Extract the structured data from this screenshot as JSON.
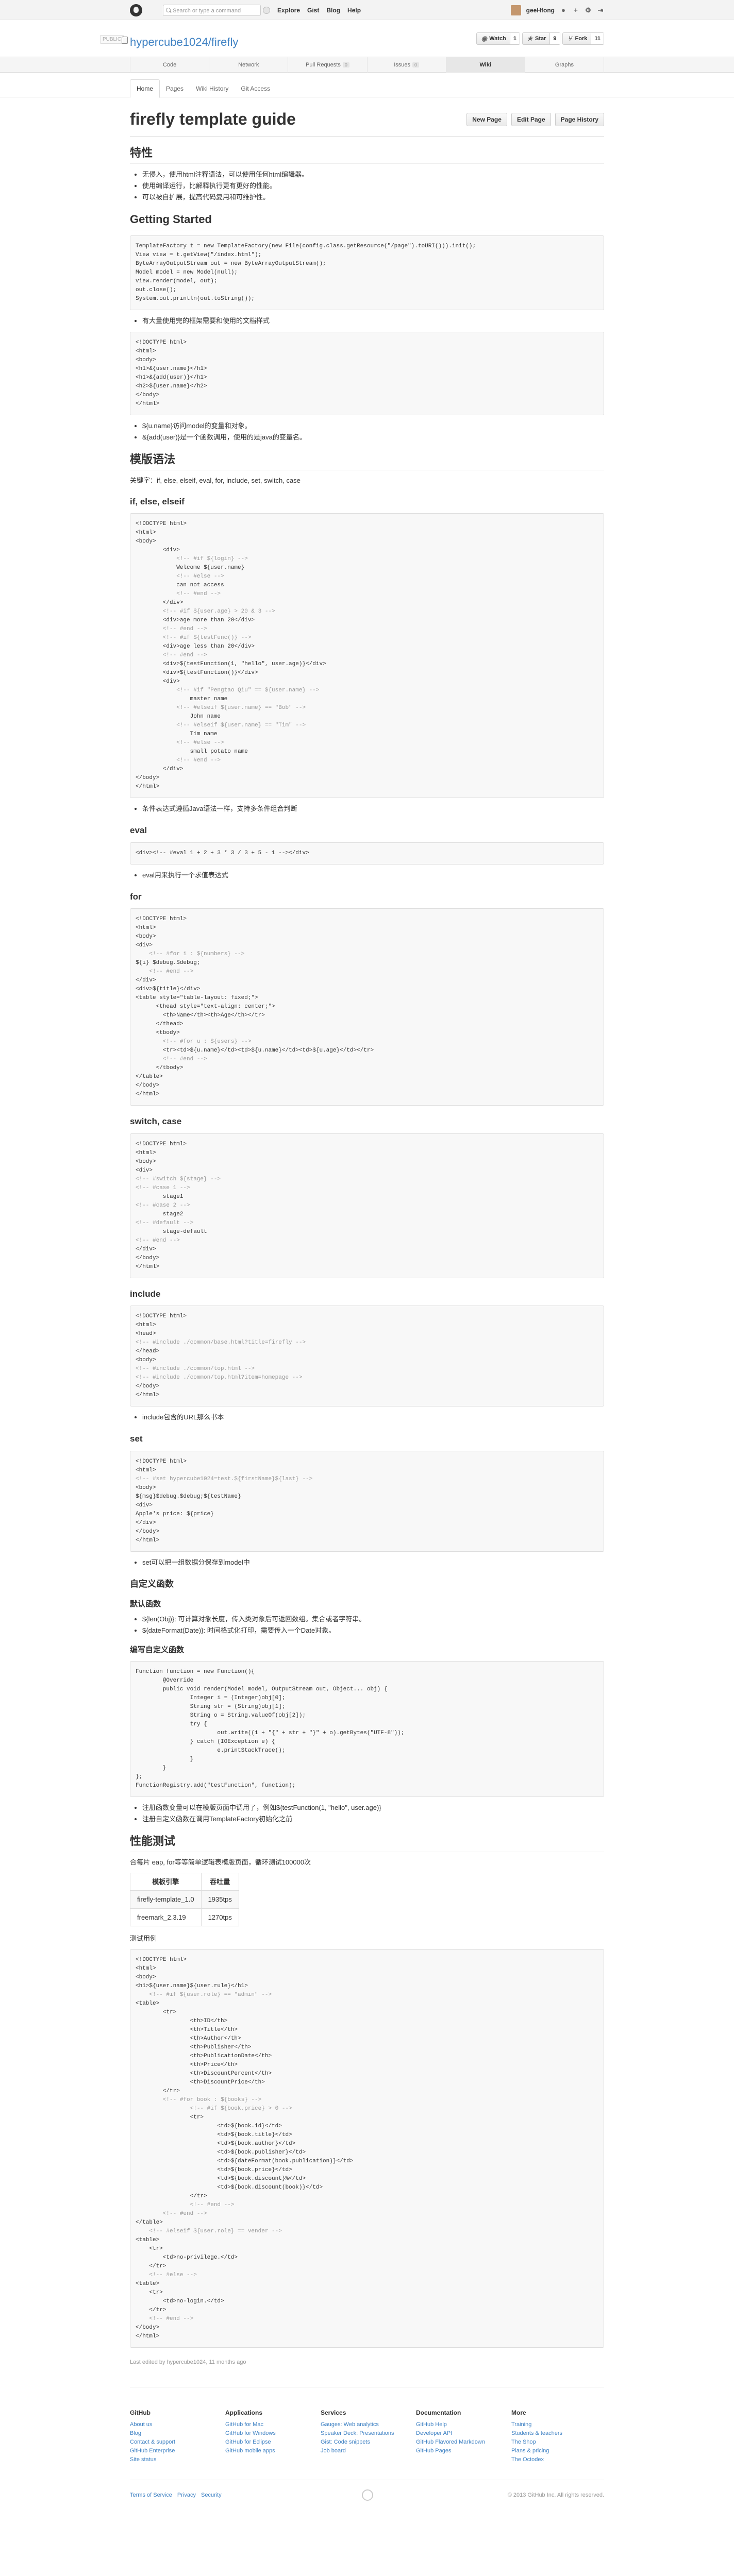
{
  "header": {
    "search_placeholder": "Search or type a command",
    "nav": [
      "Explore",
      "Gist",
      "Blog",
      "Help"
    ],
    "username": "geeHfong"
  },
  "repo": {
    "public_label": "PUBLIC",
    "owner": "hypercube1024",
    "separator": " / ",
    "name": "firefly",
    "watch": "Watch",
    "watch_count": "1",
    "star": "Star",
    "star_count": "9",
    "fork": "Fork",
    "fork_count": "11"
  },
  "tabs": [
    {
      "label": "Code",
      "count": ""
    },
    {
      "label": "Network",
      "count": ""
    },
    {
      "label": "Pull Requests",
      "count": "0"
    },
    {
      "label": "Issues",
      "count": "0"
    },
    {
      "label": "Wiki",
      "count": ""
    },
    {
      "label": "Graphs",
      "count": ""
    }
  ],
  "wiki_nav": [
    "Home",
    "Pages",
    "Wiki History",
    "Git Access"
  ],
  "page": {
    "title": "firefly template guide",
    "buttons": [
      "New Page",
      "Edit Page",
      "Page History"
    ]
  },
  "content": {
    "h_features": "特性",
    "features": [
      "无侵入，使用html注释语法，可以使用任何html编辑器。",
      "使用编译运行，比解释执行更有更好的性能。",
      "可以被自扩展，提高代码复用和可维护性。"
    ],
    "h_started": "Getting Started",
    "started_note": "有大量使用完的框架需要和使用的文档样式",
    "code_started": [
      "TemplateFactory t = new TemplateFactory(new File(config.class.getResource(\"/page\").toURI())).init();",
      "",
      "View view = t.getView(\"/index.html\");",
      "ByteArrayOutputStream out = new ByteArrayOutputStream();",
      "Model model = new Model(null);",
      "view.render(model, out);",
      "out.close();",
      "System.out.println(out.toString());"
    ],
    "started_note2": "有大量使用完的框架需要和使用的文档样式",
    "code_hello": [
      "<!DOCTYPE html>",
      "<html>",
      "<body>",
      "<h1>&{user.name}</h1>",
      "<h1>&{add(user)}</h1>",
      "<h2>${user.name}</h2>",
      "</body>",
      "</html>"
    ],
    "hello_notes": [
      "${u.name}访问model的变量和对象。",
      "&{add(user)}是一个函数调用，使用的是java的变量名。"
    ],
    "h_syntax": "模版语法",
    "syntax_intro": "关键字：if, else, elseif, eval, for, include, set, switch, case",
    "h_if": "if, else, elseif",
    "code_if": [
      "<!DOCTYPE html>",
      "<html>",
      "<body>",
      "",
      "        <div>",
      "            <!-- #if ${login} -->",
      "            Welcome ${user.name}",
      "            <!-- #else -->",
      "            can not access",
      "            <!-- #end -->",
      "        </div>",
      "",
      "        <!-- #if ${user.age} > 20 & 3 -->",
      "        <div>age more than 20</div>",
      "        <!-- #end -->",
      "",
      "        <!-- #if ${testFunc()} -->",
      "        <div>age less than 20</div>",
      "        <!-- #end -->",
      "",
      "        <div>${testFunction(1, \"hello\", user.age)}</div>",
      "        <div>${testFunction()}</div>",
      "",
      "        <div>",
      "            <!-- #if \"Pengtao Qiu\" == ${user.name} -->",
      "                master name",
      "            <!-- #elseif ${user.name} == \"Bob\" -->",
      "                John name",
      "            <!-- #elseif ${user.name} == \"Tim\" -->",
      "                Tim name",
      "            <!-- #else -->",
      "                small potato name",
      "            <!-- #end -->",
      "        </div>",
      "</body>",
      "</html>"
    ],
    "if_note": "条件表达式遵循Java语法一样，支持多条件组合判断",
    "h_eval": "eval",
    "code_eval": [
      "<div><!-- #eval 1 + 2 + 3 * 3 / 3 + 5 - 1 --></div>"
    ],
    "eval_note": "eval用来执行一个求值表达式",
    "h_for": "for",
    "code_for": [
      "<!DOCTYPE html>",
      "<html>",
      "<body>",
      "<div>",
      "    <!-- #for i : ${numbers} -->",
      "${i} $debug.$debug;",
      "    <!-- #end -->",
      "</div>",
      "",
      "<div>${title}</div>",
      "<table style=\"table-layout: fixed;\">",
      "      <thead style=\"text-align: center;\">",
      "        <th>Name</th><th>Age</th></tr>",
      "      </thead>",
      "      <tbody>",
      "        <!-- #for u : ${users} -->",
      "        <tr><td>${u.name}</td><td>${u.name}</td><td>${u.age}</td></tr>",
      "        <!-- #end -->",
      "      </tbody>",
      "</table>",
      "</body>",
      "</html>"
    ],
    "h_switch": "switch, case",
    "code_switch": [
      "<!DOCTYPE html>",
      "<html>",
      "<body>",
      "<div>",
      "<!-- #switch ${stage} -->",
      "<!-- #case 1 -->",
      "        stage1",
      "<!-- #case 2 -->",
      "        stage2",
      "<!-- #default -->",
      "        stage-default",
      "<!-- #end -->",
      "</div>",
      "</body>",
      "</html>"
    ],
    "h_include": "include",
    "code_include": [
      "<!DOCTYPE html>",
      "<html>",
      "<head>",
      "<!-- #include ./common/base.html?title=firefly -->",
      "</head>",
      "<body>",
      "<!-- #include ./common/top.html -->",
      "<!-- #include ./common/top.html?item=homepage -->",
      "</body>",
      "</html>"
    ],
    "include_note": "include包含的URL那么书本",
    "h_set": "set",
    "code_set": [
      "<!DOCTYPE html>",
      "<html>",
      "<!-- #set hypercube1024=test.${firstName}${last} -->",
      "<body>",
      "${msg}$debug.$debug;${testName}",
      "<div>",
      "Apple's price: ${price}",
      "</div>",
      "</body>",
      "</html>"
    ],
    "set_note": "set可以把一组数据分保存到model中",
    "h_funcs": "自定义函数",
    "h_builtin": "默认函数",
    "builtin_notes": [
      "${len(Obj)}: 可计算对象长度，传入类对象后可返回数组。集合或者字符串。",
      "${dateFormat(Date)}: 时间格式化打印，需要传入一个Date对象。"
    ],
    "h_custom": "编写自定义函数",
    "code_func": [
      "Function function = new Function(){",
      "        @Override",
      "        public void render(Model model, OutputStream out, Object... obj) {",
      "                Integer i = (Integer)obj[0];",
      "                String str = (String)obj[1];",
      "                String o = String.valueOf(obj[2]);",
      "",
      "                try {",
      "                        out.write((i + \"{\" + str + \"}\" + o).getBytes(\"UTF-8\"));",
      "                } catch (IOException e) {",
      "                        e.printStackTrace();",
      "                }",
      "        }",
      "};",
      "",
      "FunctionRegistry.add(\"testFunction\", function);"
    ],
    "func_notes": [
      "注册函数变量可以在模版页面中调用了，例如${testFunction(1, \"hello\", user.age)}",
      "注册自定义函数在调用TemplateFactory初始化之前"
    ],
    "h_perf": "性能测试",
    "perf_intro": "合每片 eap, for等等简单逻辑表模版页面，循环测试100000次",
    "perf_headers": [
      "模板引擎",
      "吞吐量"
    ],
    "perf_rows": [
      [
        "firefly-template_1.0",
        "1935tps"
      ],
      [
        "freemark_2.3.19",
        "1270tps"
      ]
    ],
    "perf_code_label": "测试用例",
    "code_perf": [
      "<!DOCTYPE html>",
      "<html>",
      "<body>",
      "<h1>${user.name}${user.rule}</h1>",
      "    <!-- #if ${user.role} == \"admin\" -->",
      "<table>",
      "        <tr>",
      "                <th>ID</th>",
      "                <th>Title</th>",
      "                <th>Author</th>",
      "                <th>Publisher</th>",
      "                <th>PublicationDate</th>",
      "                <th>Price</th>",
      "                <th>DiscountPercent</th>",
      "                <th>DiscountPrice</th>",
      "        </tr>",
      "        <!-- #for book : ${books} -->",
      "                <!-- #if ${book.price} > 0 -->",
      "                <tr>",
      "                        <td>${book.id}</td>",
      "                        <td>${book.title}</td>",
      "                        <td>${book.author}</td>",
      "                        <td>${book.publisher}</td>",
      "                        <td>${dateFormat(book.publication)}</td>",
      "                        <td>${book.price}</td>",
      "                        <td>${book.discount}%</td>",
      "                        <td>${book.discount(book)}</td>",
      "                </tr>",
      "                <!-- #end -->",
      "        <!-- #end -->",
      "</table>",
      "    <!-- #elseif ${user.role} == vender -->",
      "<table>",
      "    <tr>",
      "        <td>no-privilege.</td>",
      "    </tr>",
      "    <!-- #else -->",
      "<table>",
      "    <tr>",
      "        <td>no-login.</td>",
      "    </tr>",
      "    <!-- #end -->",
      "</body>",
      "</html>"
    ],
    "last_edited": "Last edited by hypercube1024, 11 months ago"
  },
  "footer": {
    "cols": [
      {
        "title": "GitHub",
        "links": [
          "About us",
          "Blog",
          "Contact & support",
          "GitHub Enterprise",
          "Site status"
        ]
      },
      {
        "title": "Applications",
        "links": [
          "GitHub for Mac",
          "GitHub for Windows",
          "GitHub for Eclipse",
          "GitHub mobile apps"
        ]
      },
      {
        "title": "Services",
        "links": [
          "Gauges: Web analytics",
          "Speaker Deck: Presentations",
          "Gist: Code snippets",
          "Job board"
        ]
      },
      {
        "title": "Documentation",
        "links": [
          "GitHub Help",
          "Developer API",
          "GitHub Flavored Markdown",
          "GitHub Pages"
        ]
      },
      {
        "title": "More",
        "links": [
          "Training",
          "Students & teachers",
          "The Shop",
          "Plans & pricing",
          "The Octodex"
        ]
      }
    ],
    "bottom_links": [
      "Terms of Service",
      "Privacy",
      "Security"
    ],
    "copyright": "© 2013 GitHub Inc. All rights reserved."
  }
}
